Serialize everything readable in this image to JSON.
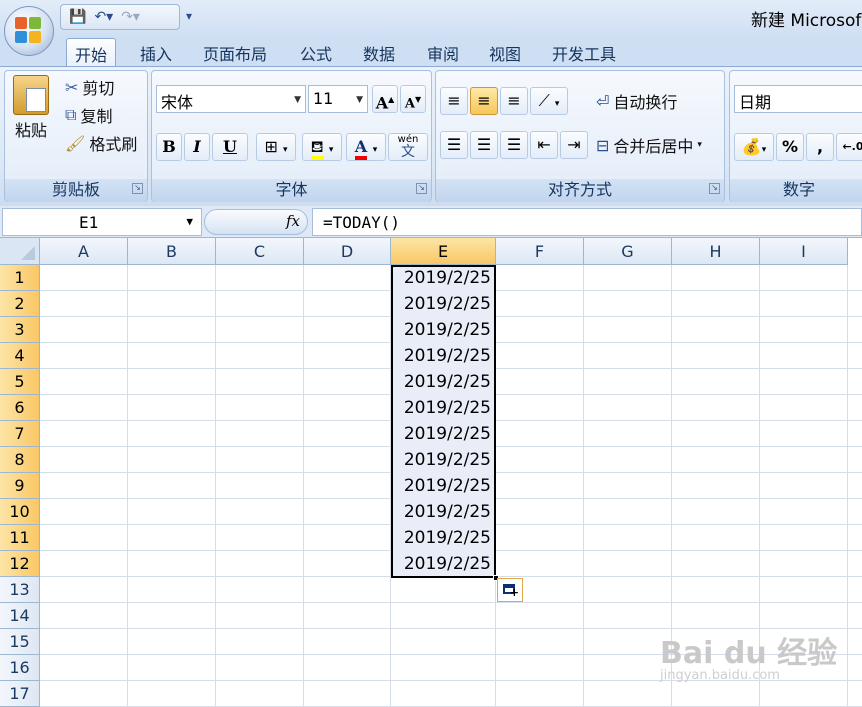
{
  "app": {
    "title": "新建 Microsof"
  },
  "quick_access": {
    "save_icon": "save-icon",
    "undo_icon": "undo-icon",
    "redo_icon": "redo-icon"
  },
  "tabs": [
    "开始",
    "插入",
    "页面布局",
    "公式",
    "数据",
    "审阅",
    "视图",
    "开发工具"
  ],
  "active_tab": "开始",
  "clipboard": {
    "paste_label": "粘贴",
    "cut_label": "剪切",
    "copy_label": "复制",
    "painter_label": "格式刷",
    "group_label": "剪贴板"
  },
  "font": {
    "name": "宋体",
    "size": "11",
    "group_label": "字体",
    "bold": "B",
    "italic": "I",
    "underline": "U",
    "wen": "wén",
    "wen_char": "文",
    "grow": "A",
    "shrink": "A",
    "color_letter": "A"
  },
  "alignment": {
    "wrap_label": "自动换行",
    "merge_label": "合并后居中",
    "group_label": "对齐方式"
  },
  "number": {
    "format": "日期",
    "percent": "%",
    "comma": ",",
    "group_label": "数字"
  },
  "formula_bar": {
    "name_box": "E1",
    "fx": "fx",
    "formula": "=TODAY()"
  },
  "sheet": {
    "columns": [
      "A",
      "B",
      "C",
      "D",
      "E",
      "F",
      "G",
      "H",
      "I"
    ],
    "selected_column": "E",
    "rows": [
      "1",
      "2",
      "3",
      "4",
      "5",
      "6",
      "7",
      "8",
      "9",
      "10",
      "11",
      "12",
      "13",
      "14",
      "15",
      "16",
      "17"
    ],
    "selected_rows": [
      1,
      2,
      3,
      4,
      5,
      6,
      7,
      8,
      9,
      10,
      11,
      12
    ],
    "e_values": [
      "2019/2/25",
      "2019/2/25",
      "2019/2/25",
      "2019/2/25",
      "2019/2/25",
      "2019/2/25",
      "2019/2/25",
      "2019/2/25",
      "2019/2/25",
      "2019/2/25",
      "2019/2/25",
      "2019/2/25"
    ]
  },
  "watermark": {
    "brand": "Bai du 经验",
    "url": "jingyan.baidu.com"
  },
  "colors": {
    "selection_header": "#f9c765",
    "ribbon": "#dce8f6",
    "grid": "#d5dde8"
  }
}
